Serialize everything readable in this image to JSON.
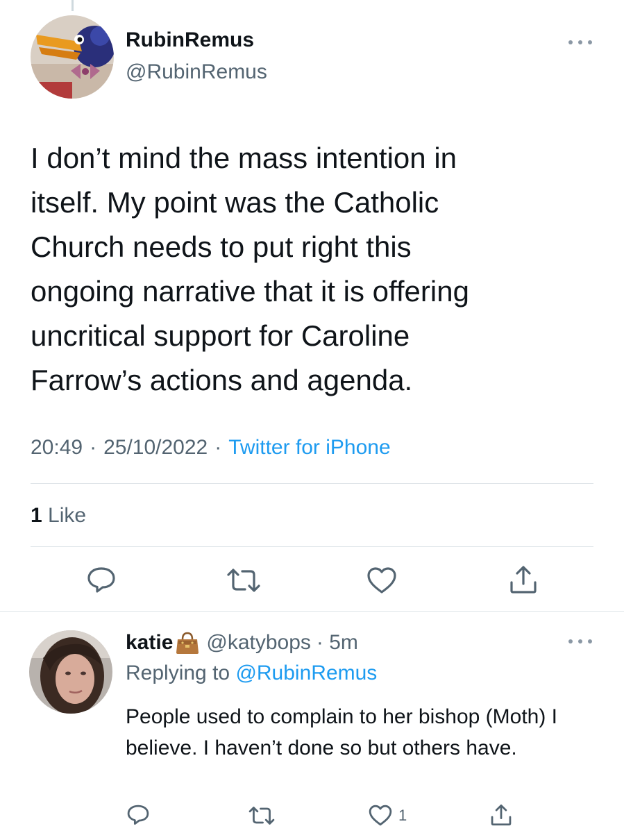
{
  "main_tweet": {
    "display_name": "RubinRemus",
    "handle": "@RubinRemus",
    "text": "I don’t mind the mass intention in\nitself. My point was the Catholic\nChurch needs to put right this\nongoing narrative that it is offering\nuncritical support for Caroline\nFarrow’s actions and agenda.",
    "time": "20:49",
    "date": "25/10/2022",
    "source": "Twitter for iPhone",
    "separator": "·",
    "likes_count": "1",
    "likes_label": "Like",
    "actions": [
      "reply-icon",
      "retweet-icon",
      "like-icon",
      "share-icon"
    ]
  },
  "reply_tweet": {
    "display_name": "katie",
    "emoji_icon": "handbag-icon",
    "handle": "@katybops",
    "time": "· 5m",
    "replying_prefix": "Replying to",
    "replying_to": "@RubinRemus",
    "text": "People used to complain to her bishop (Moth) I believe. I haven’t done so but others have.",
    "like_count": "1",
    "actions": [
      "reply-icon",
      "retweet-icon",
      "like-icon",
      "share-icon"
    ]
  },
  "colors": {
    "text": "#0f1419",
    "secondary": "#536471",
    "link": "#1d9bf0",
    "divider": "#dfe5e9"
  }
}
